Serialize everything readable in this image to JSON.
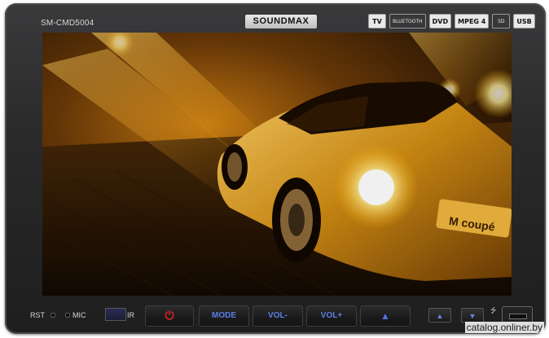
{
  "device": {
    "model": "SM-CMD5004",
    "brand": "SOUNDMAX",
    "logos": [
      "TV",
      "BLUETOOTH",
      "DVD",
      "MPEG 4",
      "SD",
      "USB"
    ]
  },
  "controls": {
    "rst_label": "RST",
    "mic_label": "MIC",
    "ir_label": "IR",
    "power_symbol": "⏻",
    "mode_label": "MODE",
    "vol_down_label": "VOL-",
    "vol_up_label": "VOL+",
    "eject_symbol": "▲",
    "up_symbol": "▲",
    "down_symbol": "▼",
    "usb_symbol": "⭍"
  },
  "screen_image": {
    "plate_text": "M coupé"
  },
  "watermark": "catalog.onliner.by"
}
